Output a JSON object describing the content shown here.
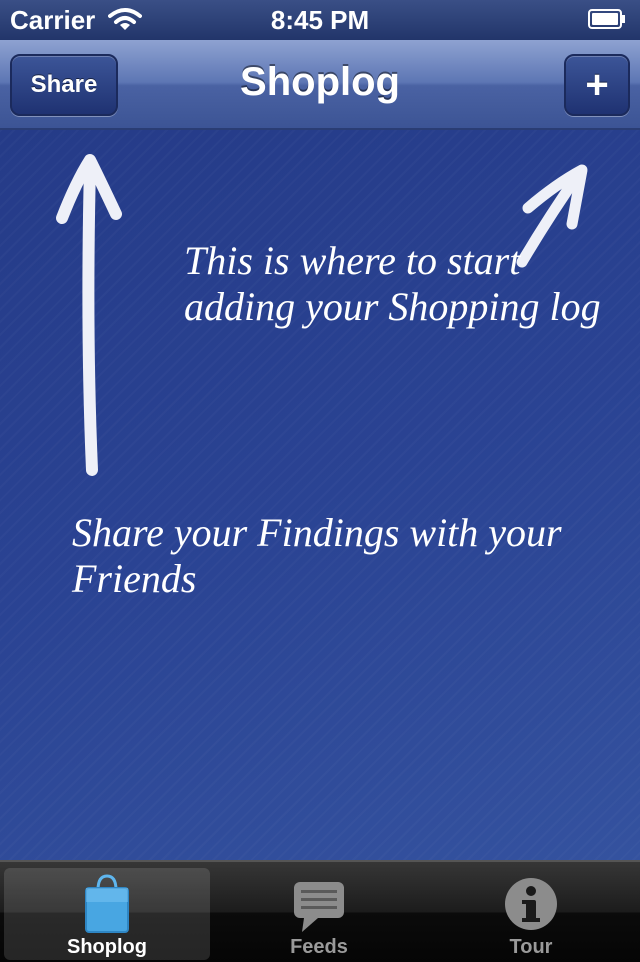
{
  "status_bar": {
    "carrier": "Carrier",
    "time": "8:45 PM"
  },
  "nav_bar": {
    "title": "Shoplog",
    "share_label": "Share",
    "add_label": "+"
  },
  "main": {
    "hint_add": "This is where to start adding your Shopping log",
    "hint_share": "Share your Findings with your Friends"
  },
  "tab_bar": {
    "tabs": [
      {
        "label": "Shoplog",
        "icon": "shopping-bag-icon",
        "active": true
      },
      {
        "label": "Feeds",
        "icon": "speech-bubble-icon",
        "active": false
      },
      {
        "label": "Tour",
        "icon": "info-icon",
        "active": false
      }
    ]
  },
  "colors": {
    "background": "#2a4393",
    "nav_bar": "#5d76b4",
    "tab_bar": "#1c1c1c",
    "active_tab_icon": "#4aa3df"
  }
}
